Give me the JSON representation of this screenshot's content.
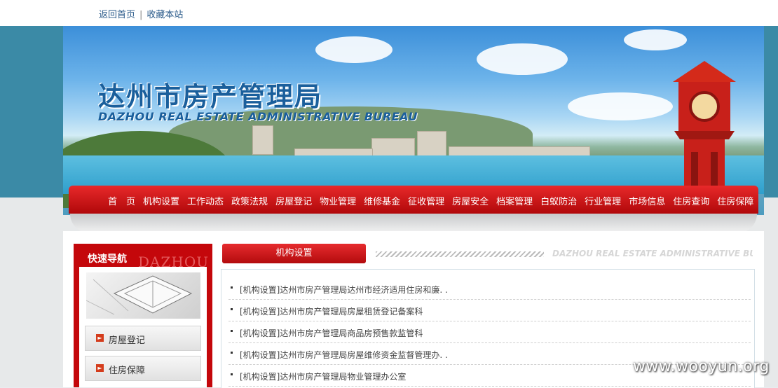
{
  "topbar": {
    "home_link": "返回首页",
    "separator": "|",
    "bookmark_link": "收藏本站"
  },
  "banner": {
    "title_cn": "达州市房产管理局",
    "title_en": "DAZHOU REAL ESTATE ADMINISTRATIVE BUREAU"
  },
  "nav": {
    "items": [
      "首　页",
      "机构设置",
      "工作动态",
      "政策法规",
      "房屋登记",
      "物业管理",
      "维修基金",
      "征收管理",
      "房屋安全",
      "档案管理",
      "白蚁防治",
      "行业管理",
      "市场信息",
      "住房查询",
      "住房保障"
    ]
  },
  "quick_nav": {
    "title": "快速导航",
    "watermark_text": "DAZHOU",
    "buttons": [
      "房屋登记",
      "住房保障"
    ]
  },
  "section": {
    "tab_label": "机构设置",
    "watermark_text": "DAZHOU REAL ESTATE ADMINISTRATIVE BUREAU",
    "items": [
      "[机构设置]达州市房产管理局达州市经济适用住房和廉. .",
      "[机构设置]达州市房产管理局房屋租赁登记备案科",
      "[机构设置]达州市房产管理局商品房预售款监管科",
      "[机构设置]达州市房产管理局房屋维修资金监督管理办. .",
      "[机构设置]达州市房产管理局物业管理办公室"
    ]
  },
  "overlay_watermark": "www.wooyun.org"
}
